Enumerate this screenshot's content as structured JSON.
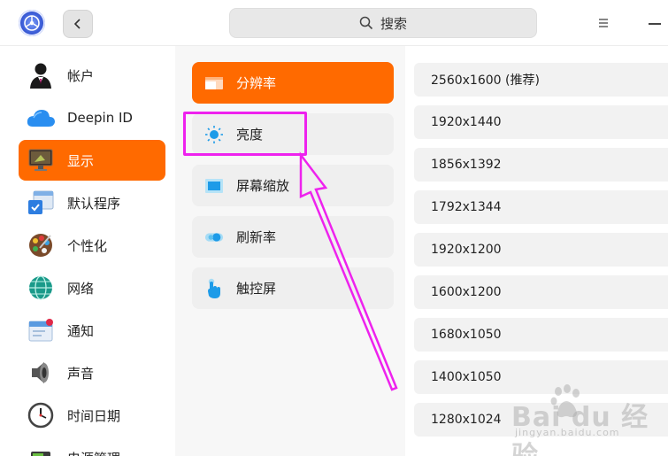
{
  "titlebar": {
    "search_placeholder": "搜索"
  },
  "sidebar": {
    "items": [
      {
        "label": "帐户",
        "icon": "account-avatar-icon"
      },
      {
        "label": "Deepin ID",
        "icon": "cloud-icon"
      },
      {
        "label": "显示",
        "icon": "display-monitor-icon",
        "active": true
      },
      {
        "label": "默认程序",
        "icon": "default-apps-icon"
      },
      {
        "label": "个性化",
        "icon": "palette-icon"
      },
      {
        "label": "网络",
        "icon": "network-globe-icon"
      },
      {
        "label": "通知",
        "icon": "notification-icon"
      },
      {
        "label": "声音",
        "icon": "speaker-icon"
      },
      {
        "label": "时间日期",
        "icon": "clock-icon"
      },
      {
        "label": "电源管理",
        "icon": "battery-icon"
      }
    ]
  },
  "display_menu": {
    "items": [
      {
        "label": "分辨率",
        "icon": "resolution-icon",
        "active": true
      },
      {
        "label": "亮度",
        "icon": "brightness-sun-icon"
      },
      {
        "label": "屏幕缩放",
        "icon": "screen-scale-icon"
      },
      {
        "label": "刷新率",
        "icon": "refresh-rate-icon"
      },
      {
        "label": "触控屏",
        "icon": "touch-hand-icon"
      }
    ]
  },
  "resolutions": [
    "2560x1600 (推荐)",
    "1920x1440",
    "1856x1392",
    "1792x1344",
    "1920x1200",
    "1600x1200",
    "1680x1050",
    "1400x1050",
    "1280x1024"
  ],
  "watermark": {
    "brand": "Bai  du 经验",
    "url": "jingyan.baidu.com"
  },
  "colors": {
    "accent": "#ff6a00",
    "annotation": "#ee22ee"
  }
}
